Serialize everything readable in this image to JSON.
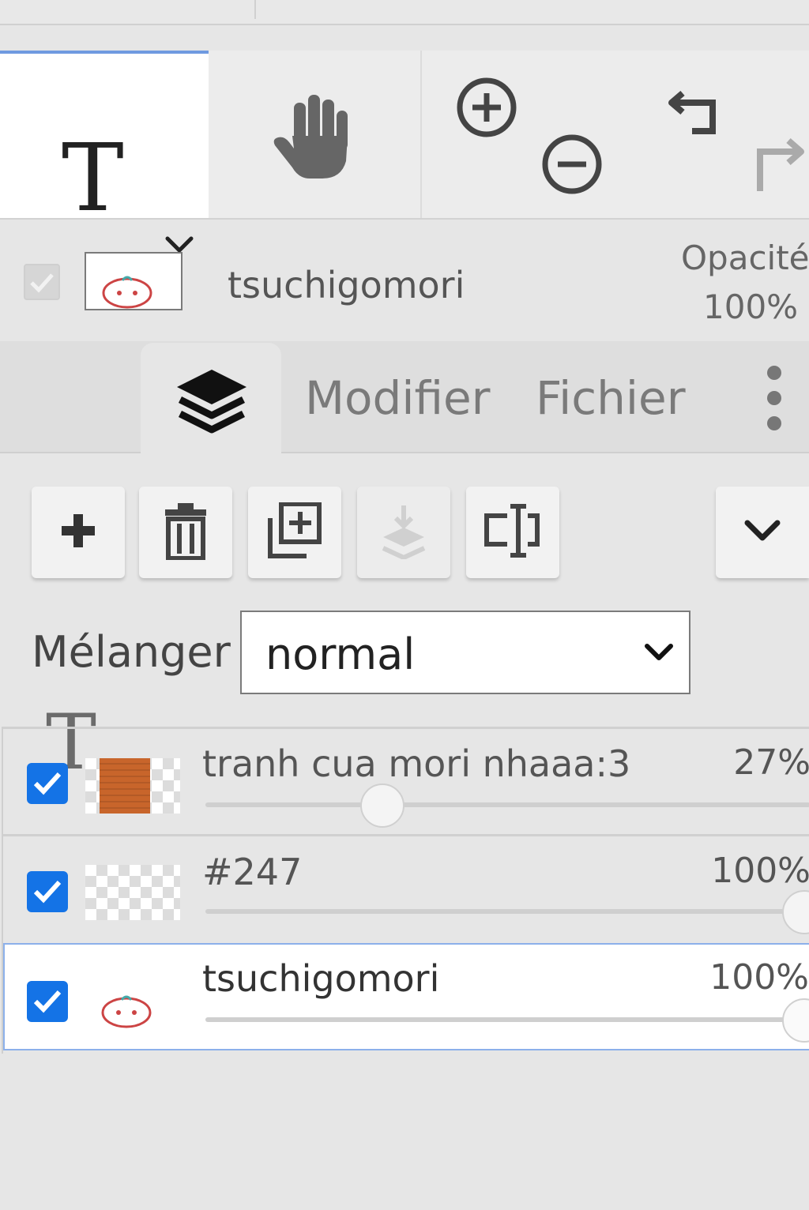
{
  "toolbar": {
    "tools": [
      {
        "name": "text-tool",
        "icon": "text-T-icon",
        "active": true
      },
      {
        "name": "hand-tool",
        "icon": "hand-icon"
      },
      {
        "name": "zoom-in",
        "icon": "zoom-in-icon"
      },
      {
        "name": "zoom-out",
        "icon": "zoom-out-icon"
      },
      {
        "name": "undo",
        "icon": "undo-icon"
      },
      {
        "name": "redo",
        "icon": "redo-icon",
        "disabled": true
      }
    ],
    "text_tool_glyph": "T"
  },
  "current_layer": {
    "name": "tsuchigomori",
    "opacity_label": "Opacité",
    "opacity_value": "100%"
  },
  "tabs": {
    "text_glyph": "T",
    "layers_icon": "layers-icon",
    "modifier": "Modifier",
    "fichier": "Fichier",
    "more_icon": "more-vertical-icon"
  },
  "layer_actions": [
    {
      "name": "add-layer",
      "icon": "plus-icon"
    },
    {
      "name": "delete-layer",
      "icon": "trash-icon"
    },
    {
      "name": "duplicate-layer",
      "icon": "duplicate-icon"
    },
    {
      "name": "merge-down",
      "icon": "merge-down-icon",
      "disabled": true
    },
    {
      "name": "rename-layer",
      "icon": "text-cursor-box-icon"
    },
    {
      "name": "more-options",
      "icon": "chevron-down-icon"
    }
  ],
  "blend": {
    "label": "Mélanger",
    "value": "normal"
  },
  "layers": [
    {
      "name": "tranh cua mori nhaaa:3",
      "opacity": "27%",
      "opacity_fraction": 0.27,
      "visible": true,
      "selected": false
    },
    {
      "name": "#247",
      "opacity": "100%",
      "opacity_fraction": 1.0,
      "visible": true,
      "selected": false
    },
    {
      "name": "tsuchigomori",
      "opacity": "100%",
      "opacity_fraction": 1.0,
      "visible": true,
      "selected": true
    }
  ],
  "colors": {
    "accent": "#1473e6",
    "selection_border": "#8cb0ea",
    "active_tool_border": "#6f9ae0"
  }
}
